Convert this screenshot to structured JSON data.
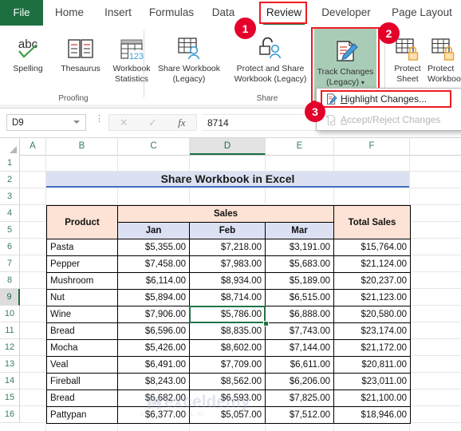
{
  "ribbon": {
    "tabs": [
      {
        "label": "File",
        "id": "file"
      },
      {
        "label": "Home",
        "id": "home"
      },
      {
        "label": "Insert",
        "id": "insert"
      },
      {
        "label": "Formulas",
        "id": "formulas"
      },
      {
        "label": "Data",
        "id": "data"
      },
      {
        "label": "Review",
        "id": "review"
      },
      {
        "label": "Developer",
        "id": "developer"
      },
      {
        "label": "Page Layout",
        "id": "page-layout"
      }
    ],
    "active_tab": "Review",
    "groups": [
      {
        "label": "Proofing"
      },
      {
        "label": "Share"
      }
    ],
    "buttons": [
      {
        "label": "Spelling",
        "icon": "abc-check-icon"
      },
      {
        "label": "Thesaurus",
        "icon": "book-icon"
      },
      {
        "label": "Workbook\nStatistics",
        "line1": "Workbook",
        "line2": "Statistics",
        "icon": "grid-123-icon"
      },
      {
        "label": "Share Workbook (Legacy)",
        "line1": "Share Workbook",
        "line2": "(Legacy)",
        "icon": "share-workbook-icon"
      },
      {
        "label": "Protect and Share Workbook (Legacy)",
        "line1": "Protect and Share",
        "line2": "Workbook (Legacy)",
        "icon": "lock-person-icon"
      },
      {
        "label": "Track Changes (Legacy)",
        "line1": "Track Changes",
        "line2": "(Legacy)",
        "icon": "track-changes-icon",
        "highlighted": true
      },
      {
        "label": "Protect Sheet",
        "line1": "Protect",
        "line2": "Sheet",
        "icon": "protect-sheet-icon"
      },
      {
        "label": "Protect Workbook",
        "line1": "Protect",
        "line2": "Workbook",
        "icon": "protect-workbook-icon"
      }
    ]
  },
  "menu": {
    "items": [
      {
        "label": "Highlight Changes...",
        "underline": "H",
        "rest": "ighlight Changes...",
        "icon": "highlight-changes-icon",
        "enabled": true
      },
      {
        "label": "Accept/Reject Changes",
        "underline": "A",
        "rest": "ccept/Reject Changes",
        "icon": "accept-reject-icon",
        "enabled": false
      }
    ]
  },
  "annotations": {
    "badges": [
      "1",
      "2",
      "3"
    ],
    "accent_red": "#e4002b",
    "box_red": "#ee1b24"
  },
  "formula_bar": {
    "name_box": "D9",
    "formula_value": "8714",
    "cancel_icon": "cancel-icon",
    "enter_icon": "enter-icon",
    "fx_icon": "insert-function-icon"
  },
  "grid": {
    "columns": [
      "A",
      "B",
      "C",
      "D",
      "E",
      "F"
    ],
    "selected_column": "D",
    "rows": [
      "1",
      "2",
      "3",
      "4",
      "5",
      "6",
      "7",
      "8",
      "9",
      "10",
      "11",
      "12",
      "13",
      "14",
      "15",
      "16"
    ],
    "selected_row": "9",
    "selected_cell": "D9",
    "banner_title": "Share Workbook in Excel",
    "watermark": "exceldemy",
    "watermark_sub": "EXCEL & EXCEL BI"
  },
  "table": {
    "headers": {
      "product": "Product",
      "sales": "Sales",
      "total": "Total Sales",
      "months": [
        "Jan",
        "Feb",
        "Mar"
      ]
    },
    "rows": [
      {
        "product": "Pasta",
        "jan": "$5,355.00",
        "feb": "$7,218.00",
        "mar": "$3,191.00",
        "total": "$15,764.00"
      },
      {
        "product": "Pepper",
        "jan": "$7,458.00",
        "feb": "$7,983.00",
        "mar": "$5,683.00",
        "total": "$21,124.00"
      },
      {
        "product": "Mushroom",
        "jan": "$6,114.00",
        "feb": "$8,934.00",
        "mar": "$5,189.00",
        "total": "$20,237.00"
      },
      {
        "product": "Nut",
        "jan": "$5,894.00",
        "feb": "$8,714.00",
        "mar": "$6,515.00",
        "total": "$21,123.00"
      },
      {
        "product": "Wine",
        "jan": "$7,906.00",
        "feb": "$5,786.00",
        "mar": "$6,888.00",
        "total": "$20,580.00"
      },
      {
        "product": "Bread",
        "jan": "$6,596.00",
        "feb": "$8,835.00",
        "mar": "$7,743.00",
        "total": "$23,174.00"
      },
      {
        "product": "Mocha",
        "jan": "$5,426.00",
        "feb": "$8,602.00",
        "mar": "$7,144.00",
        "total": "$21,172.00"
      },
      {
        "product": "Veal",
        "jan": "$6,491.00",
        "feb": "$7,709.00",
        "mar": "$6,611.00",
        "total": "$20,811.00"
      },
      {
        "product": "Fireball",
        "jan": "$8,243.00",
        "feb": "$8,562.00",
        "mar": "$6,206.00",
        "total": "$23,011.00"
      },
      {
        "product": "Bread",
        "jan": "$6,682.00",
        "feb": "$6,593.00",
        "mar": "$7,825.00",
        "total": "$21,100.00"
      },
      {
        "product": "Pattypan",
        "jan": "$6,377.00",
        "feb": "$5,057.00",
        "mar": "$7,512.00",
        "total": "$18,946.00"
      }
    ]
  },
  "colors": {
    "excel_green": "#1d6f42",
    "header_peach": "#fce3d5",
    "header_lavender": "#dbe0f2",
    "banner_fill": "#dce1f2",
    "banner_border": "#4472c4",
    "highlight_green": "#a9ccb6"
  }
}
